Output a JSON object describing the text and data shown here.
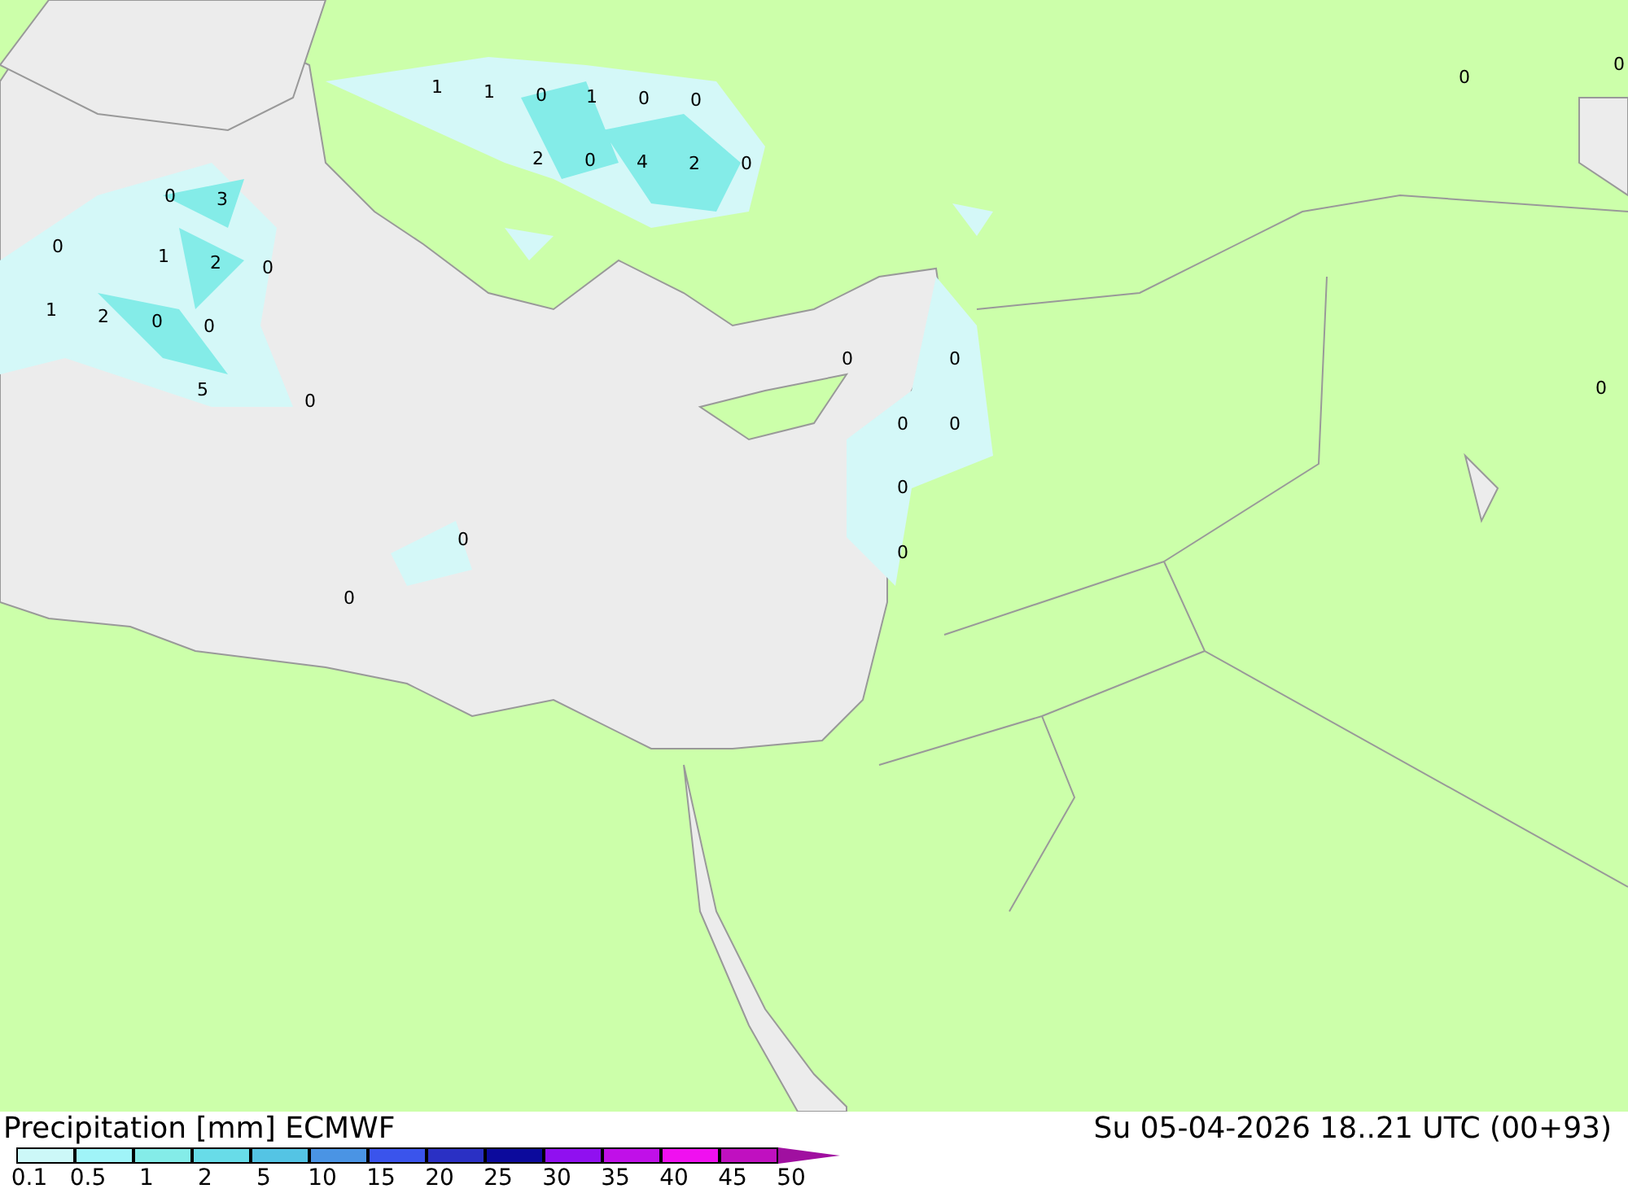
{
  "map": {
    "values": [
      "1",
      "1",
      "0",
      "1",
      "0",
      "0",
      "2",
      "0",
      "4",
      "2",
      "0",
      "0",
      "3",
      "0",
      "1",
      "2",
      "0",
      "1",
      "2",
      "0",
      "0",
      "5",
      "0",
      "0",
      "0",
      "0",
      "0",
      "0",
      "0",
      "0",
      "0",
      "0",
      "0",
      "0"
    ]
  },
  "title": "Precipitation [mm] ECMWF",
  "valid_time": "Su 05-04-2026 18..21 UTC (00+93)",
  "legend": [
    {
      "label": "0.1",
      "color": "#ccf8f8"
    },
    {
      "label": "0.5",
      "color": "#a0f4f8"
    },
    {
      "label": "1",
      "color": "#84ece8"
    },
    {
      "label": "2",
      "color": "#68dce8"
    },
    {
      "label": "5",
      "color": "#54c4e4"
    },
    {
      "label": "10",
      "color": "#4a94e4"
    },
    {
      "label": "15",
      "color": "#3a54ec"
    },
    {
      "label": "20",
      "color": "#2a30c4"
    },
    {
      "label": "25",
      "color": "#0c0a9c"
    },
    {
      "label": "30",
      "color": "#9010f0"
    },
    {
      "label": "35",
      "color": "#c010e8"
    },
    {
      "label": "40",
      "color": "#f010f0"
    },
    {
      "label": "45",
      "color": "#c010c0"
    },
    {
      "label": "50",
      "color": "#a010a0"
    }
  ]
}
